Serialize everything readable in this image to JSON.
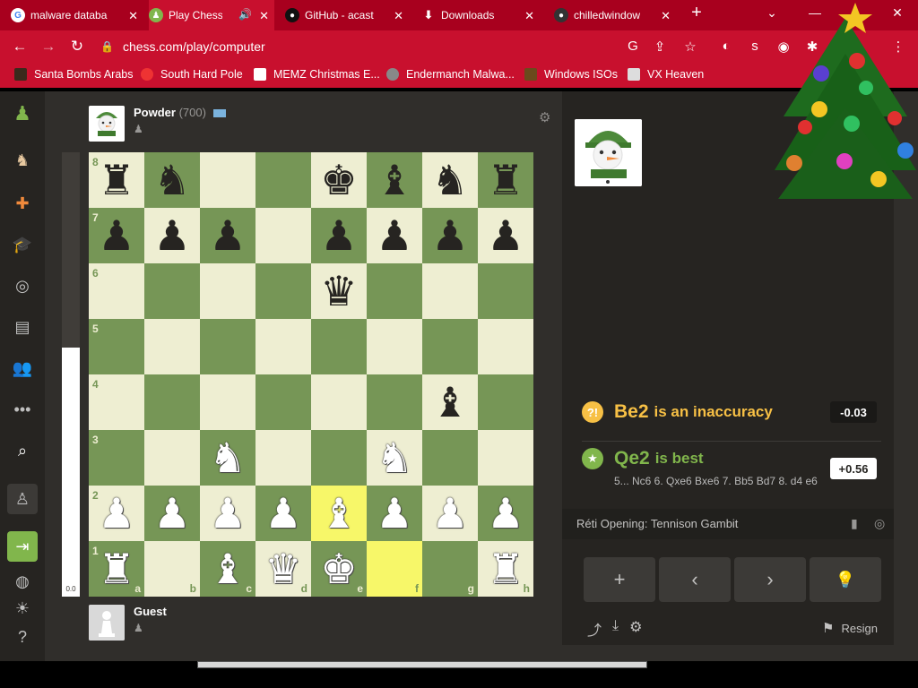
{
  "browser": {
    "tabs": [
      {
        "title": "malware databa",
        "active": false
      },
      {
        "title": "Play Chess",
        "active": true
      },
      {
        "title": "GitHub - acast",
        "active": false
      },
      {
        "title": "Downloads",
        "active": false
      },
      {
        "title": "chilledwindow",
        "active": false
      }
    ],
    "new_tab": "+",
    "url": "chess.com/play/computer",
    "bookmarks": [
      {
        "label": "Santa Bombs Arabs"
      },
      {
        "label": "South Hard Pole"
      },
      {
        "label": "MEMZ Christmas E..."
      },
      {
        "label": "Endermanch Malwa..."
      },
      {
        "label": "Windows ISOs"
      },
      {
        "label": "VX Heaven"
      }
    ]
  },
  "opponent": {
    "name": "Powder",
    "rating": "(700)"
  },
  "player": {
    "name": "Guest"
  },
  "eval_bar": {
    "score": "0.0",
    "white_fraction": 0.56
  },
  "board": {
    "ranks": [
      "8",
      "7",
      "6",
      "5",
      "4",
      "3",
      "2",
      "1"
    ],
    "files": [
      "a",
      "b",
      "c",
      "d",
      "e",
      "f",
      "g",
      "h"
    ],
    "rows": [
      [
        "r",
        "n",
        "",
        "",
        "k",
        "b",
        "n",
        "r"
      ],
      [
        "p",
        "p",
        "p",
        "",
        "p",
        "p",
        "p",
        "p"
      ],
      [
        "",
        "",
        "",
        "",
        "q",
        "",
        "",
        ""
      ],
      [
        "",
        "",
        "",
        "",
        "",
        "",
        "",
        ""
      ],
      [
        "",
        "",
        "",
        "",
        "",
        "",
        "b",
        ""
      ],
      [
        "",
        "",
        "N",
        "",
        "",
        "N",
        "",
        ""
      ],
      [
        "P",
        "P",
        "P",
        "P",
        "B",
        "P",
        "P",
        "P"
      ],
      [
        "R",
        "",
        "B",
        "Q",
        "K",
        "",
        "",
        "R"
      ]
    ],
    "highlights": [
      "e2",
      "f1"
    ]
  },
  "coach": {
    "move1": "Be2",
    "text1": "is an inaccuracy",
    "eval1": "-0.03",
    "move2": "Qe2",
    "text2": "is best",
    "eval2": "+0.56",
    "line": "5... Nc6 6. Qxe6 Bxe6 7. Bb5 Bd7 8. d4 e6",
    "icon1": "?!",
    "icon2": "★"
  },
  "opening": "Réti Opening: Tennison Gambit",
  "controls": {
    "add": "+",
    "prev": "‹",
    "next": "›",
    "hint": "💡"
  },
  "resign": "Resign",
  "colors": {
    "accent_green": "#81b64c",
    "inaccuracy": "#f7c045",
    "best": "#81b64c",
    "board_light": "#eeeed2",
    "board_dark": "#769656",
    "highlight": "#f7f769"
  }
}
